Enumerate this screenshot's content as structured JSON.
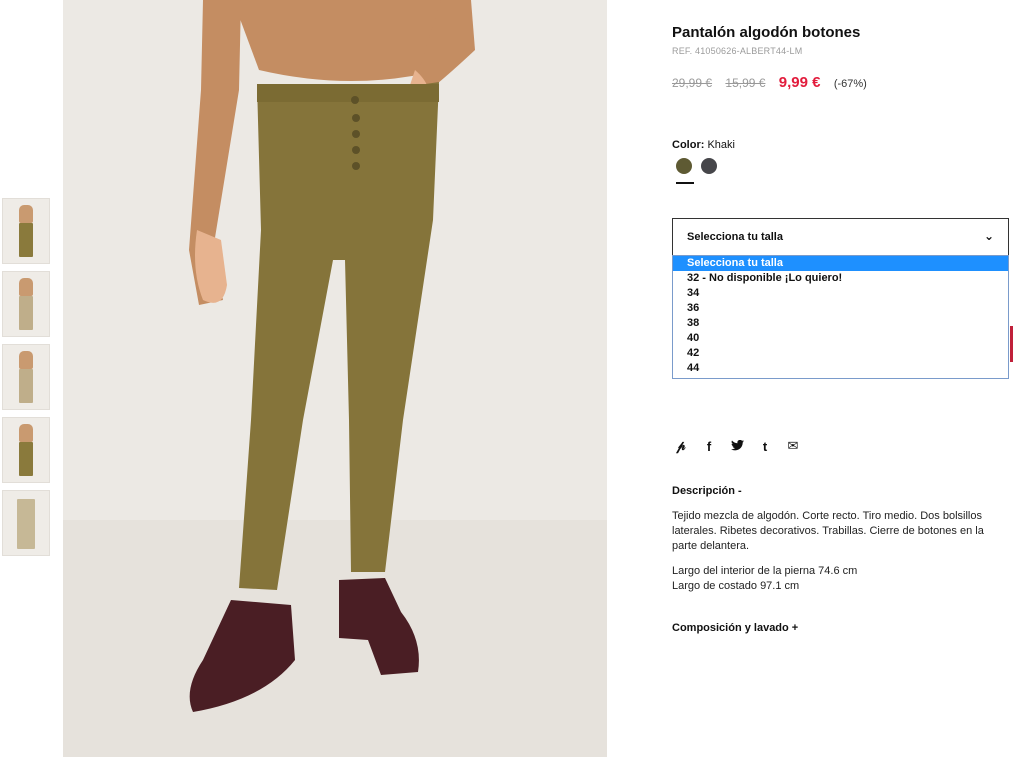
{
  "product": {
    "title": "Pantalón algodón botones",
    "ref": "REF. 41050626-ALBERT44-LM",
    "price_original": "29,99 €",
    "price_previous": "15,99 €",
    "price_sale": "9,99 €",
    "discount": "(-67%)"
  },
  "color": {
    "label": "Color:",
    "value": "Khaki",
    "swatches": [
      {
        "name": "khaki",
        "hex": "#5e5a33"
      },
      {
        "name": "charcoal",
        "hex": "#46464a"
      }
    ]
  },
  "size_select": {
    "label": "Selecciona tu talla",
    "options": [
      "Selecciona tu talla",
      "32 - No disponible ¡Lo quiero!",
      "34",
      "36",
      "38",
      "40",
      "42",
      "44"
    ]
  },
  "share_icons": [
    "pinterest-icon",
    "facebook-icon",
    "twitter-icon",
    "tumblr-icon",
    "mail-icon"
  ],
  "description": {
    "heading": "Descripción -",
    "text": "Tejido mezcla de algodón. Corte recto. Tiro medio. Dos bolsillos laterales. Ribetes decorativos. Trabillas. Cierre de botones en la parte delantera.",
    "measure_1": "Largo del interior de la pierna 74.6 cm",
    "measure_2": "Largo de costado 97.1 cm"
  },
  "composition": {
    "heading": "Composición y lavado +"
  },
  "colors": {
    "sale": "#e21c3c",
    "selected_option": "#1e90ff"
  }
}
